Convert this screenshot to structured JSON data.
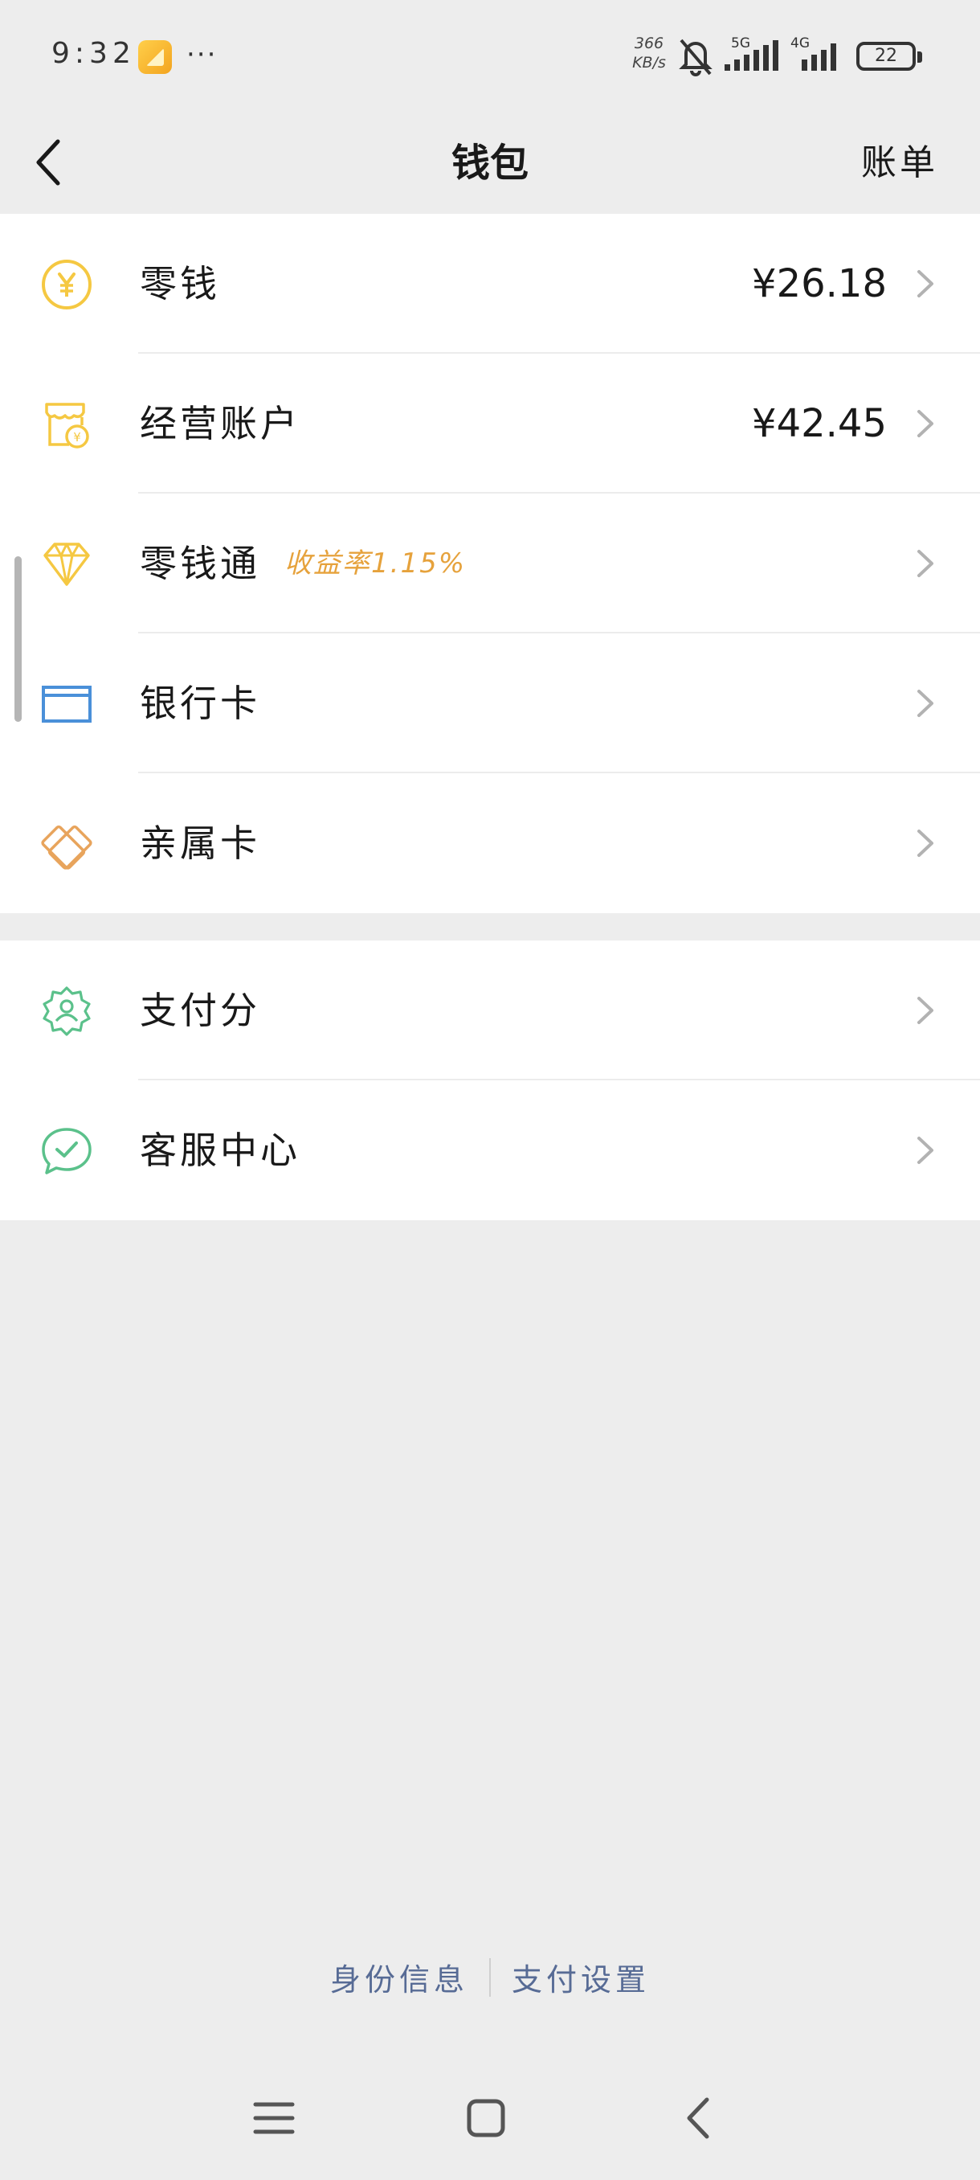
{
  "status_bar": {
    "time": "9:32",
    "more": "···",
    "net_speed_value": "366",
    "net_speed_unit": "KB/s",
    "signal1": "5G",
    "signal2": "4G",
    "battery": "22"
  },
  "nav": {
    "title": "钱包",
    "bill": "账单"
  },
  "group1": [
    {
      "label": "零钱",
      "value": "¥26.18",
      "icon": "yuan-coin-icon",
      "color": "#f5c842"
    },
    {
      "label": "经营账户",
      "value": "¥42.45",
      "icon": "store-account-icon",
      "color": "#f5c842"
    },
    {
      "label": "零钱通",
      "sub": "收益率1.15%",
      "icon": "diamond-icon",
      "color": "#f5c842"
    },
    {
      "label": "银行卡",
      "icon": "bank-card-icon",
      "color": "#4a90d9"
    },
    {
      "label": "亲属卡",
      "icon": "family-card-icon",
      "color": "#e8a45c"
    }
  ],
  "group2": [
    {
      "label": "支付分",
      "icon": "pay-score-icon",
      "color": "#5bc18b"
    },
    {
      "label": "客服中心",
      "icon": "customer-service-icon",
      "color": "#5bc18b"
    }
  ],
  "footer": {
    "identity": "身份信息",
    "pay_settings": "支付设置"
  },
  "colors": {
    "background": "#ededed",
    "link": "#576b95",
    "rate": "#e6a23c"
  }
}
